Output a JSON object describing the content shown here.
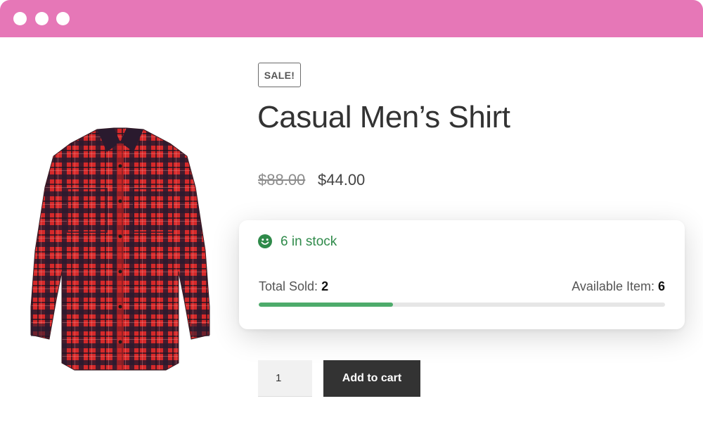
{
  "window": {
    "accent_color": "#e677b7"
  },
  "product": {
    "badge": "SALE!",
    "title": "Casual Men’s Shirt",
    "price_old": "$88.00",
    "price_new": "$44.00",
    "image": "red-plaid-shirt-image"
  },
  "stock": {
    "status_text": "6 in stock",
    "status_color": "#2f8a4a",
    "total_sold_label": "Total Sold:",
    "total_sold_value": "2",
    "available_label": "Available Item:",
    "available_value": "6",
    "progress_fraction": 0.33,
    "progress_color": "#4dab6b"
  },
  "cart": {
    "quantity": "1",
    "add_label": "Add to cart"
  }
}
